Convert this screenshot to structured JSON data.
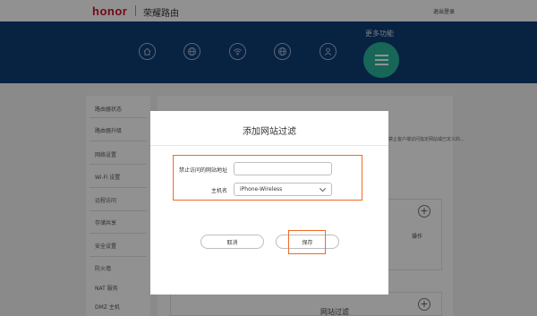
{
  "header": {
    "brand": "honor",
    "app_title": "荣耀路由",
    "logout_label": "退出登录"
  },
  "nav": {
    "more_label": "更多功能",
    "icons": [
      "home-icon",
      "globe-icon",
      "wifi-icon",
      "globe-icon",
      "user-icon"
    ]
  },
  "sidebar": {
    "items": [
      "路由器状态",
      "路由器升级",
      "网络设置",
      "Wi-Fi 设置",
      "远程访问",
      "存储共享",
      "安全设置",
      "防火墙",
      "NAT 服务",
      "DMZ 主机"
    ]
  },
  "background": {
    "note": "禁止客户端访问指定网站或已定义的...",
    "operation_header": "操作",
    "section_title": "网站过滤"
  },
  "dialog": {
    "title": "添加网站过滤",
    "url_label": "禁止访问的网站地址",
    "url_value": "",
    "url_placeholder": "",
    "host_label": "主机名",
    "host_value": "iPhone-Wireless",
    "cancel_label": "取消",
    "save_label": "保存"
  },
  "colors": {
    "header_blue": "#0f3d75",
    "menu_teal": "#2bb39a",
    "highlight_orange": "#f06b23",
    "brand_red": "#c8102e"
  }
}
